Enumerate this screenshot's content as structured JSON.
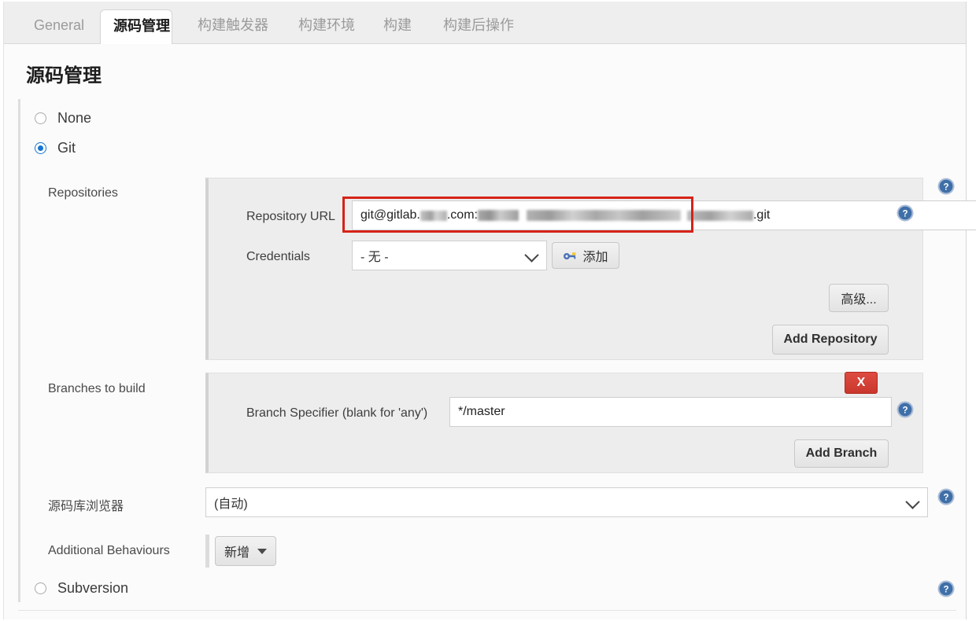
{
  "window": {
    "accent_blue": "#1675d1",
    "help_blue": "#3f6fa8",
    "danger_red": "#c9372d",
    "highlight_red": "#d62318"
  },
  "tabs": [
    {
      "label": "General",
      "active": false
    },
    {
      "label": "源码管理",
      "active": true
    },
    {
      "label": "构建触发器",
      "active": false
    },
    {
      "label": "构建环境",
      "active": false
    },
    {
      "label": "构建",
      "active": false
    },
    {
      "label": "构建后操作",
      "active": false
    }
  ],
  "page_title": "源码管理",
  "scm_options": [
    {
      "label": "None",
      "selected": false
    },
    {
      "label": "Git",
      "selected": true
    },
    {
      "label": "Subversion",
      "selected": false
    }
  ],
  "repositories": {
    "label": "Repositories",
    "repository_url": {
      "label": "Repository URL",
      "prefix": "git@gitlab.",
      "middle": ".com:",
      "suffix": ".git",
      "redacted": true
    },
    "credentials": {
      "label": "Credentials",
      "value": "- 无 -",
      "add_button": "添加",
      "add_icon": "key-icon"
    },
    "advanced_button": "高级...",
    "add_repository_button": "Add Repository"
  },
  "branches": {
    "label": "Branches to build",
    "delete_button": "X",
    "specifier_label": "Branch Specifier (blank for 'any')",
    "specifier_value": "*/master",
    "add_branch_button": "Add Branch"
  },
  "repository_browser": {
    "label": "源码库浏览器",
    "value": "(自动)"
  },
  "additional_behaviours": {
    "label": "Additional Behaviours",
    "add_button": "新增"
  },
  "icons": {
    "help": "?",
    "chevron_down": "chevron-down-icon"
  }
}
